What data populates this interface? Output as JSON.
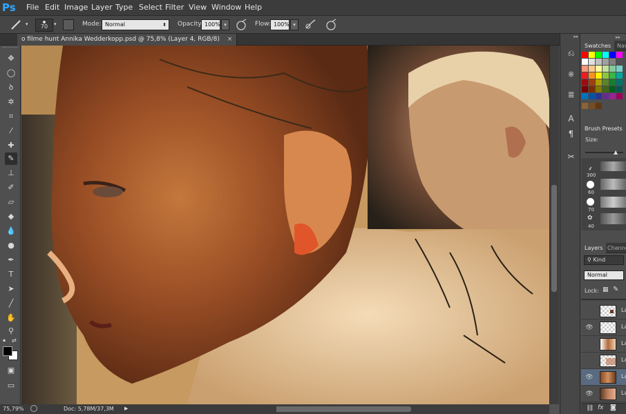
{
  "app": {
    "logo": "Ps"
  },
  "menu": [
    "File",
    "Edit",
    "Image",
    "Layer",
    "Type",
    "Select",
    "Filter",
    "View",
    "Window",
    "Help"
  ],
  "options": {
    "brush_size": "70",
    "mode_label": "Mode:",
    "mode_value": "Normal",
    "opacity_label": "Opacity:",
    "opacity_value": "100%",
    "flow_label": "Flow:",
    "flow_value": "100%"
  },
  "document": {
    "tab_title": "o filme hunt Annika Wedderkopp.psd @ 75,8% (Layer 4, RGB/8)",
    "close": "×"
  },
  "status": {
    "zoom": "75,79%",
    "doc": "Doc: 5,78M/37,3M"
  },
  "panels": {
    "swatches_tab": "Swatches",
    "navigator_tab": "Nav",
    "brush_presets_tab": "Brush Presets",
    "size_label": "Size:",
    "brush_sizes": [
      "300",
      "60",
      "70",
      "40"
    ],
    "layers_tab": "Layers",
    "channels_tab": "Channe",
    "kind_label": "Kind",
    "blend_mode": "Normal",
    "lock_label": "Lock:",
    "layers": [
      {
        "name": "La",
        "visible": false
      },
      {
        "name": "La",
        "visible": true
      },
      {
        "name": "La",
        "visible": false
      },
      {
        "name": "La",
        "visible": false
      },
      {
        "name": "La",
        "visible": true,
        "selected": true
      },
      {
        "name": "La",
        "visible": true
      }
    ]
  },
  "colors": {
    "accent": "#31a8ff",
    "menubar": "#3c3c3c",
    "panel": "#4d4d4d"
  }
}
